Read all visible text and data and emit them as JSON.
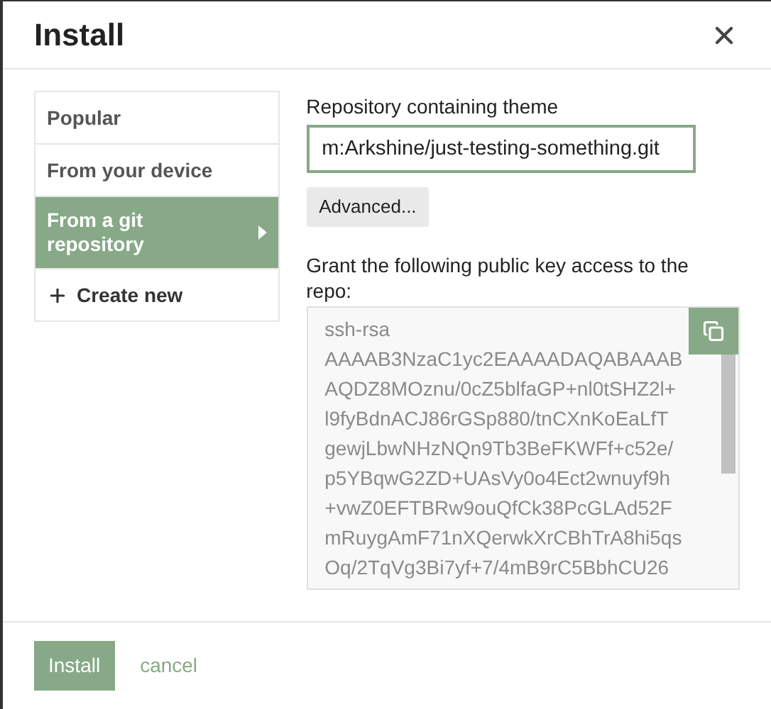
{
  "dialog": {
    "title": "Install"
  },
  "sidebar": {
    "items": [
      {
        "label": "Popular",
        "selected": false,
        "kind": "tab"
      },
      {
        "label": "From your device",
        "selected": false,
        "kind": "tab"
      },
      {
        "label": "From a git repository",
        "selected": true,
        "kind": "tab"
      },
      {
        "label": "Create new",
        "selected": false,
        "kind": "create"
      }
    ]
  },
  "repository": {
    "label": "Repository containing theme",
    "value": "m:Arkshine/just-testing-something.git"
  },
  "advanced_button": "Advanced...",
  "key": {
    "label": "Grant the following public key access to the repo:",
    "lines": [
      "ssh-rsa",
      "AAAAB3NzaC1yc2EAAAADAQABAAAB",
      "AQDZ8MOznu/0cZ5blfaGP+nl0tSHZ2l+",
      "l9fyBdnACJ86rGSp880/tnCXnKoEaLfT",
      "gewjLbwNHzNQn9Tb3BeFKWFf+c52e/",
      "p5YBqwG2ZD+UAsVy0o4Ect2wnuyf9h",
      "+vwZ0EFTBRw9ouQfCk38PcGLAd52F",
      "mRuygAmF71nXQerwkXrCBhTrA8hi5qs",
      "Oq/2TqVg3Bi7yf+7/4mB9rC5BbhCU26"
    ]
  },
  "footer": {
    "install": "Install",
    "cancel": "cancel"
  }
}
